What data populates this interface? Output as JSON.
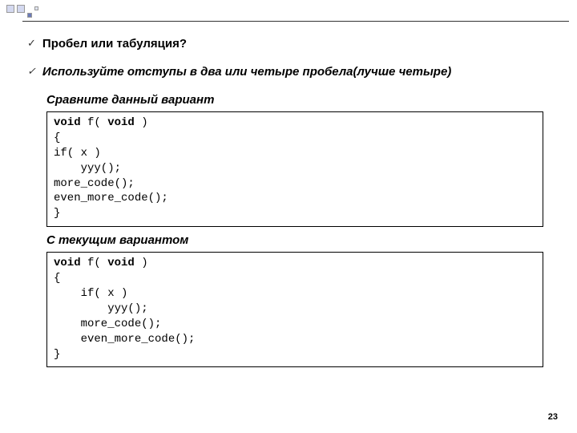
{
  "deco": {},
  "bullet1": "Пробел или табуляция?",
  "bullet2": "Используйте отступы в два или четыре пробела(лучше четыре)",
  "heading1": "Сравните данный вариант",
  "code1": {
    "kw1": "void",
    "t1": " f( ",
    "kw2": "void",
    "t2": " )",
    "l2": "{",
    "l3": "if( x )",
    "l4": "    yyy();",
    "l5": "more_code();",
    "l6": "even_more_code();",
    "l7": "}"
  },
  "heading2": "С текущим вариантом",
  "code2": {
    "kw1": "void",
    "t1": " f( ",
    "kw2": "void",
    "t2": " )",
    "l2": "{",
    "l3": "    if( x )",
    "l4": "        yyy();",
    "l5": "    more_code();",
    "l6": "    even_more_code();",
    "l7": "}"
  },
  "pageNumber": "23"
}
